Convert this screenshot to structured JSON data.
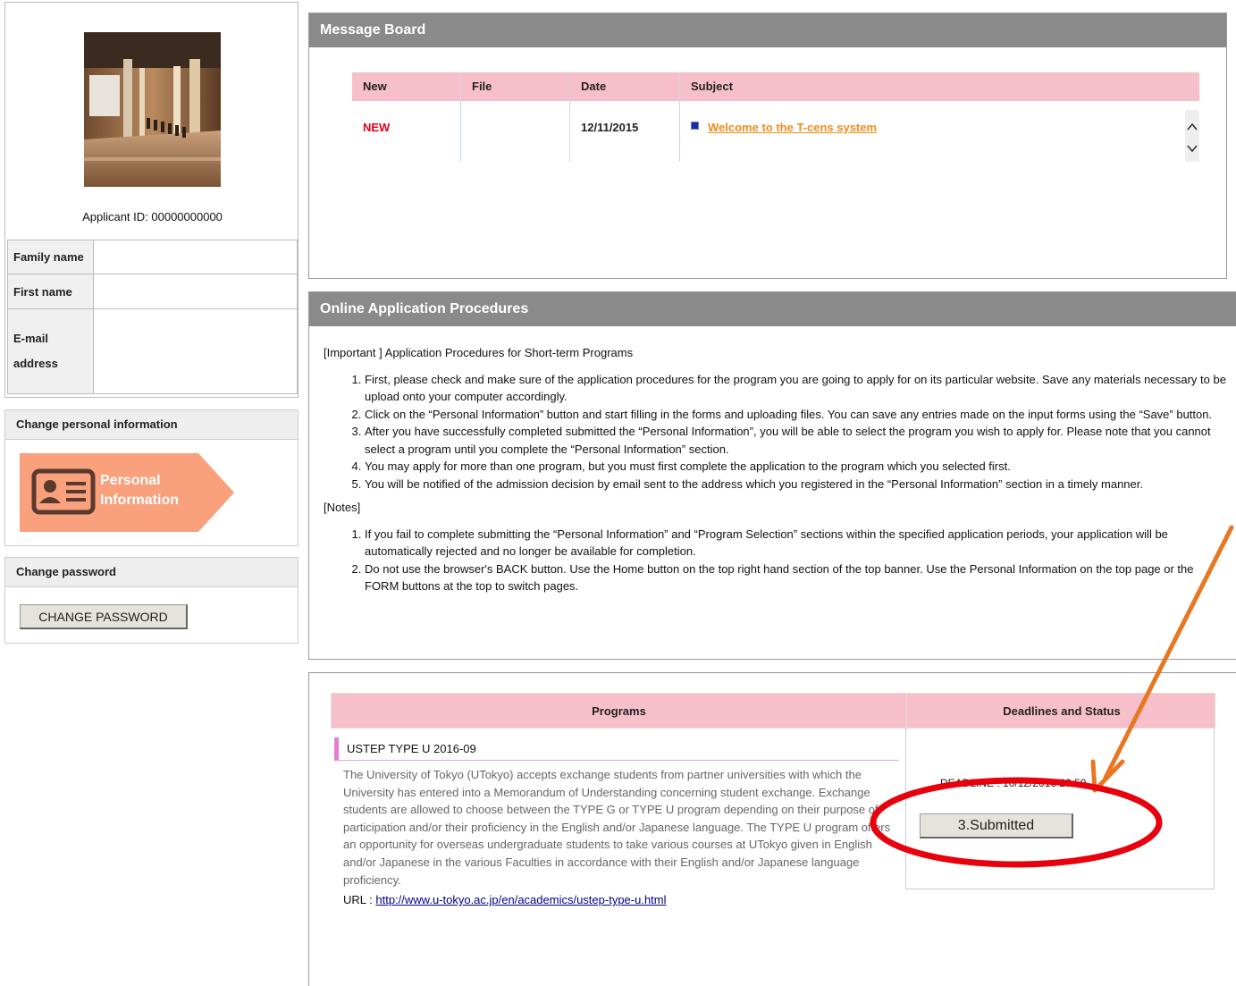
{
  "profile": {
    "applicant_id_label": "Applicant ID: 00000000000",
    "fields": [
      {
        "label": "Family name",
        "value": ""
      },
      {
        "label": "First name",
        "value": ""
      },
      {
        "label": "E-mail address",
        "value": ""
      }
    ]
  },
  "sidebar": {
    "personal": {
      "heading": "Change personal information",
      "button_line1": "Personal",
      "button_line2": "Information",
      "button_color": "#f9a07c"
    },
    "password": {
      "heading": "Change password",
      "button_label": "CHANGE PASSWORD"
    }
  },
  "message_board": {
    "title": "Message Board",
    "columns": [
      "New",
      "File",
      "Date",
      "Subject"
    ],
    "rows": [
      {
        "new": "NEW",
        "file": "",
        "date": "12/11/2015",
        "subject": "Welcome to the T-cens system"
      }
    ]
  },
  "procedures": {
    "title": "Online Application Procedures",
    "intro": "[Important ] Application Procedures for Short-term Programs",
    "steps": [
      "First, please check and make sure of the application procedures for the program you are going to apply for on its particular website. Save any materials necessary to be upload onto your computer accordingly.",
      "Click on the “Personal Information” button and start filling in the forms and uploading files. You can save any entries made on the input forms using the “Save” button.",
      "After you have successfully completed submitted the “Personal Information”, you will be able to select the program you wish to apply for. Please note that you cannot select a program until you complete the “Personal Information” section.",
      "You may apply for more than one program, but you must first complete the application to the program which you selected first.",
      "You will be notified of the admission decision by email sent to the address which you registered in the “Personal Information” section in a timely manner."
    ],
    "notes_title": "[Notes]",
    "notes": [
      "If you fail to complete submitting the “Personal Information” and “Program Selection” sections within the specified application periods, your application will be automatically rejected and no longer be available for completion.",
      "Do not use the browser's BACK button. Use the Home button on the top right hand section of the top banner. Use the Personal Information on the top page or the FORM buttons at the top to switch pages."
    ]
  },
  "programs": {
    "col_programs": "Programs",
    "col_deadlines": "Deadlines and Status",
    "item": {
      "name": "USTEP TYPE U 2016-09",
      "description": "The University of Tokyo (UTokyo) accepts exchange students from partner universities with which the University has entered into a Memorandum of Understanding concerning student exchange. Exchange students are allowed to choose between the TYPE G or TYPE U program depending on their purpose of participation and/or their proficiency in the English and/or Japanese language. The TYPE U  program offers an opportunity for overseas undergraduate students to take various courses at UTokyo given in English and/or Japanese in the various Faculties in accordance with their English and/or Japanese language proficiency.",
      "url_label": "URL : ",
      "url": "http://www.u-tokyo.ac.jp/en/academics/ustep-type-u.html",
      "deadline": "DEADLINE : 10/12/2016 23:59",
      "status_button": "3.Submitted"
    }
  },
  "colors": {
    "panel_header": "#8a8a8a",
    "table_header_pink": "#f7bfca",
    "new_red": "#e0001a",
    "link_orange": "#ef8c18",
    "annotation_arrow": "#e87722",
    "annotation_circle": "#e8000d"
  }
}
